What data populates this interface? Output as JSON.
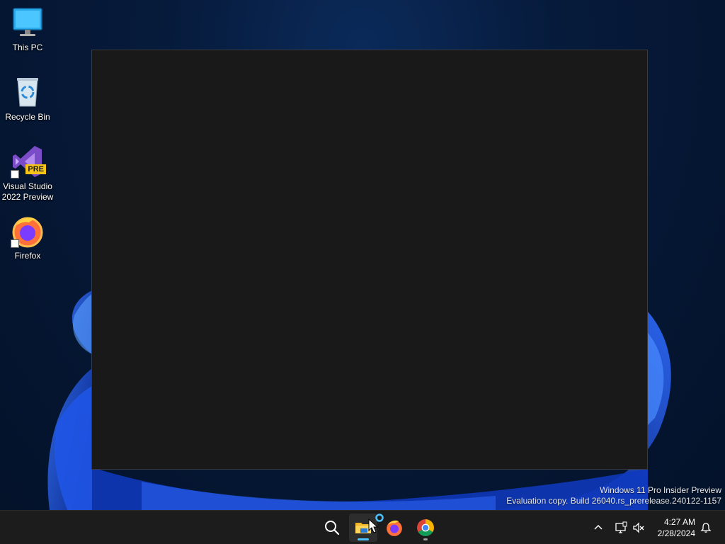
{
  "desktop": {
    "icons": [
      {
        "label": "This PC",
        "icon": "monitor-icon"
      },
      {
        "label": "Recycle Bin",
        "icon": "recycle-bin-icon"
      },
      {
        "label": "Visual Studio 2022 Preview",
        "icon": "visual-studio-icon",
        "badge": "PRE"
      },
      {
        "label": "Firefox",
        "icon": "firefox-icon"
      }
    ],
    "watermark": {
      "line1": "Windows 11 Pro Insider Preview",
      "line2": "Evaluation copy. Build 26040.rs_prerelease.240122-1157"
    }
  },
  "taskbar": {
    "apps": [
      {
        "name": "Search",
        "icon": "search-icon"
      },
      {
        "name": "File Explorer",
        "icon": "folder-icon",
        "active": true
      },
      {
        "name": "Firefox",
        "icon": "firefox-icon"
      },
      {
        "name": "Google Chrome",
        "icon": "chrome-icon"
      }
    ],
    "clock": {
      "time": "4:27 AM",
      "date": "2/28/2024"
    }
  },
  "colors": {
    "accent": "#4cc2ff",
    "taskbar": "#1c1c1c",
    "window": "#191919"
  }
}
